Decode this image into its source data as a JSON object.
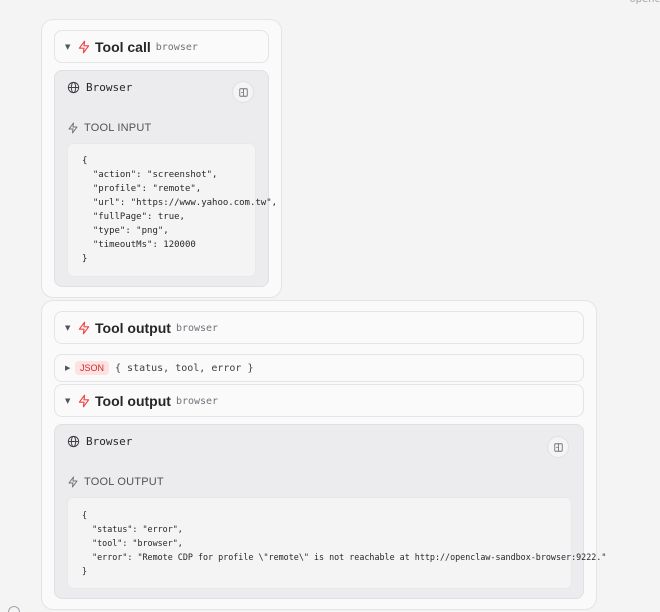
{
  "corner_text": "openc",
  "tool_call": {
    "title": "Tool call",
    "tag": "browser",
    "panel_title": "Browser",
    "section_label": "TOOL INPUT",
    "code": "{\n  \"action\": \"screenshot\",\n  \"profile\": \"remote\",\n  \"url\": \"https://www.yahoo.com.tw\",\n  \"fullPage\": true,\n  \"type\": \"png\",\n  \"timeoutMs\": 120000\n}"
  },
  "output_1": {
    "title": "Tool output",
    "tag": "browser"
  },
  "json_row": {
    "badge": "JSON",
    "summary": "{ status, tool, error }"
  },
  "output_2": {
    "title": "Tool output",
    "tag": "browser",
    "panel_title": "Browser",
    "section_label": "TOOL OUTPUT",
    "code": "{\n  \"status\": \"error\",\n  \"tool\": \"browser\",\n  \"error\": \"Remote CDP for profile \\\"remote\\\" is not reachable at http://openclaw-sandbox-browser:9222.\"\n}"
  },
  "colors": {
    "accent_red": "#ef4444",
    "badge_bg": "#fde2e2"
  },
  "icons": {
    "bolt": "bolt-icon",
    "globe": "globe-icon",
    "expand": "expand-icon",
    "caret": "caret-down-icon"
  }
}
